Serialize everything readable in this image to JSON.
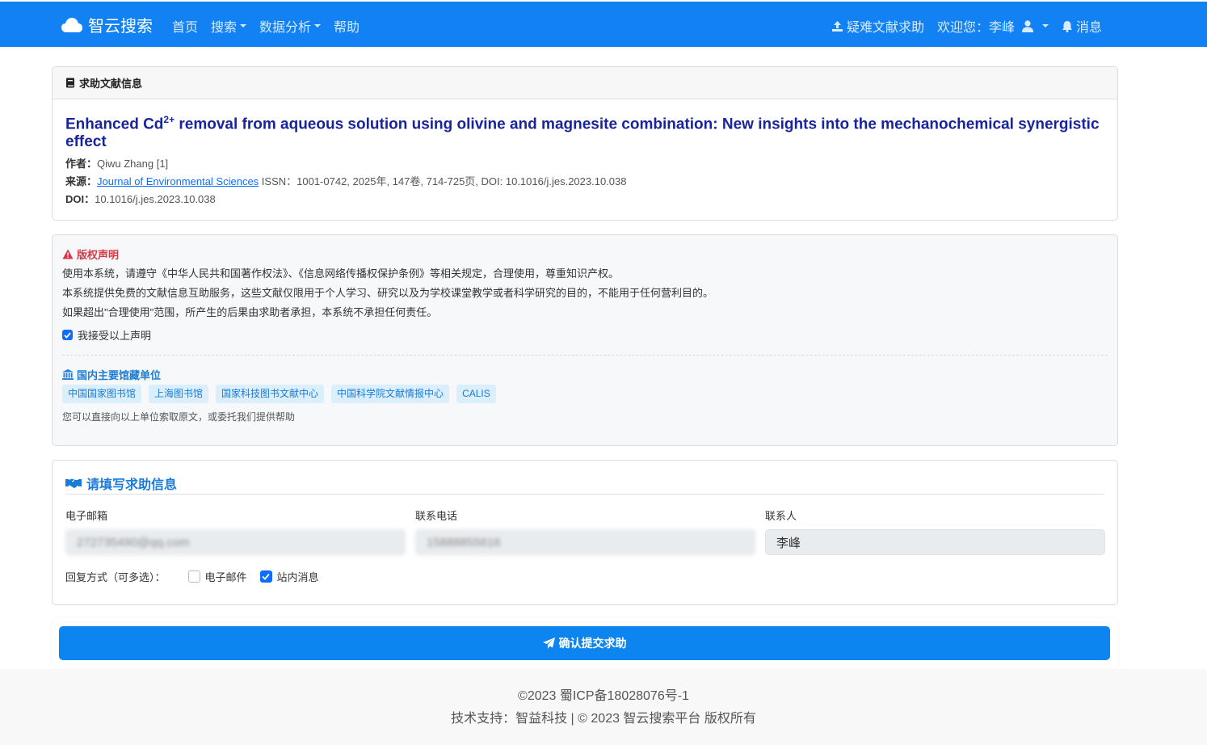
{
  "nav": {
    "brand": "智云搜索",
    "items": [
      {
        "label": "首页",
        "dropdown": false
      },
      {
        "label": "搜索",
        "dropdown": true
      },
      {
        "label": "数据分析",
        "dropdown": true
      },
      {
        "label": "帮助",
        "dropdown": false
      }
    ],
    "help_request": "疑难文献求助",
    "welcome": "欢迎您：李峰",
    "messages": "消息"
  },
  "paper": {
    "header": "求助文献信息",
    "title_pre": "Enhanced Cd",
    "title_sup": "2+",
    "title_post": " removal from aqueous solution using olivine and magnesite combination: New insights into the mechanochemical synergistic effect",
    "author_label": "作者：",
    "author": "Qiwu Zhang [1]",
    "source_label": "来源：",
    "source_link": "Journal of Environmental Sciences",
    "source_rest": " ISSN：1001-0742, 2025年, 147卷, 714-725页, DOI: 10.1016/j.jes.2023.10.038",
    "doi_label": "DOI：",
    "doi": "10.1016/j.jes.2023.10.038"
  },
  "copyright": {
    "title": "版权声明",
    "lines": [
      "使用本系统，请遵守《中华人民共和国著作权法》、《信息网络传播权保护条例》等相关规定，合理使用，尊重知识产权。",
      "本系统提供免费的文献信息互助服务，这些文献仅限用于个人学习、研究以及为学校课堂教学或者科学研究的目的，不能用于任何营利目的。",
      "如果超出\"合理使用\"范围，所产生的后果由求助者承担，本系统不承担任何责任。"
    ],
    "accept_label": "我接受以上声明",
    "accepted": true
  },
  "libraries": {
    "title": "国内主要馆藏单位",
    "tags": [
      "中国国家图书馆",
      "上海图书馆",
      "国家科技图书文献中心",
      "中国科学院文献情报中心",
      "CALIS"
    ],
    "note": "您可以直接向以上单位索取原文，或委托我们提供帮助"
  },
  "form": {
    "title": "请填写求助信息",
    "email_label": "电子邮箱",
    "email_value": "272735490@qq.com",
    "phone_label": "联系电话",
    "phone_value": "15888855616",
    "contact_label": "联系人",
    "contact_value": "李峰",
    "reply_label": "回复方式（可多选）：",
    "reply_email": "电子邮件",
    "reply_email_checked": false,
    "reply_site": "站内消息",
    "reply_site_checked": true
  },
  "submit_label": "确认提交求助",
  "footer": {
    "line1": "©2023 蜀ICP备18028076号-1",
    "line2": "技术支持：智益科技 | © 2023 智云搜索平台 版权所有"
  },
  "colors": {
    "navbar": "#1181f4",
    "title": "#18249b",
    "accent": "#1a7bd8",
    "danger": "#dc3545",
    "button": "#0d85f0"
  }
}
